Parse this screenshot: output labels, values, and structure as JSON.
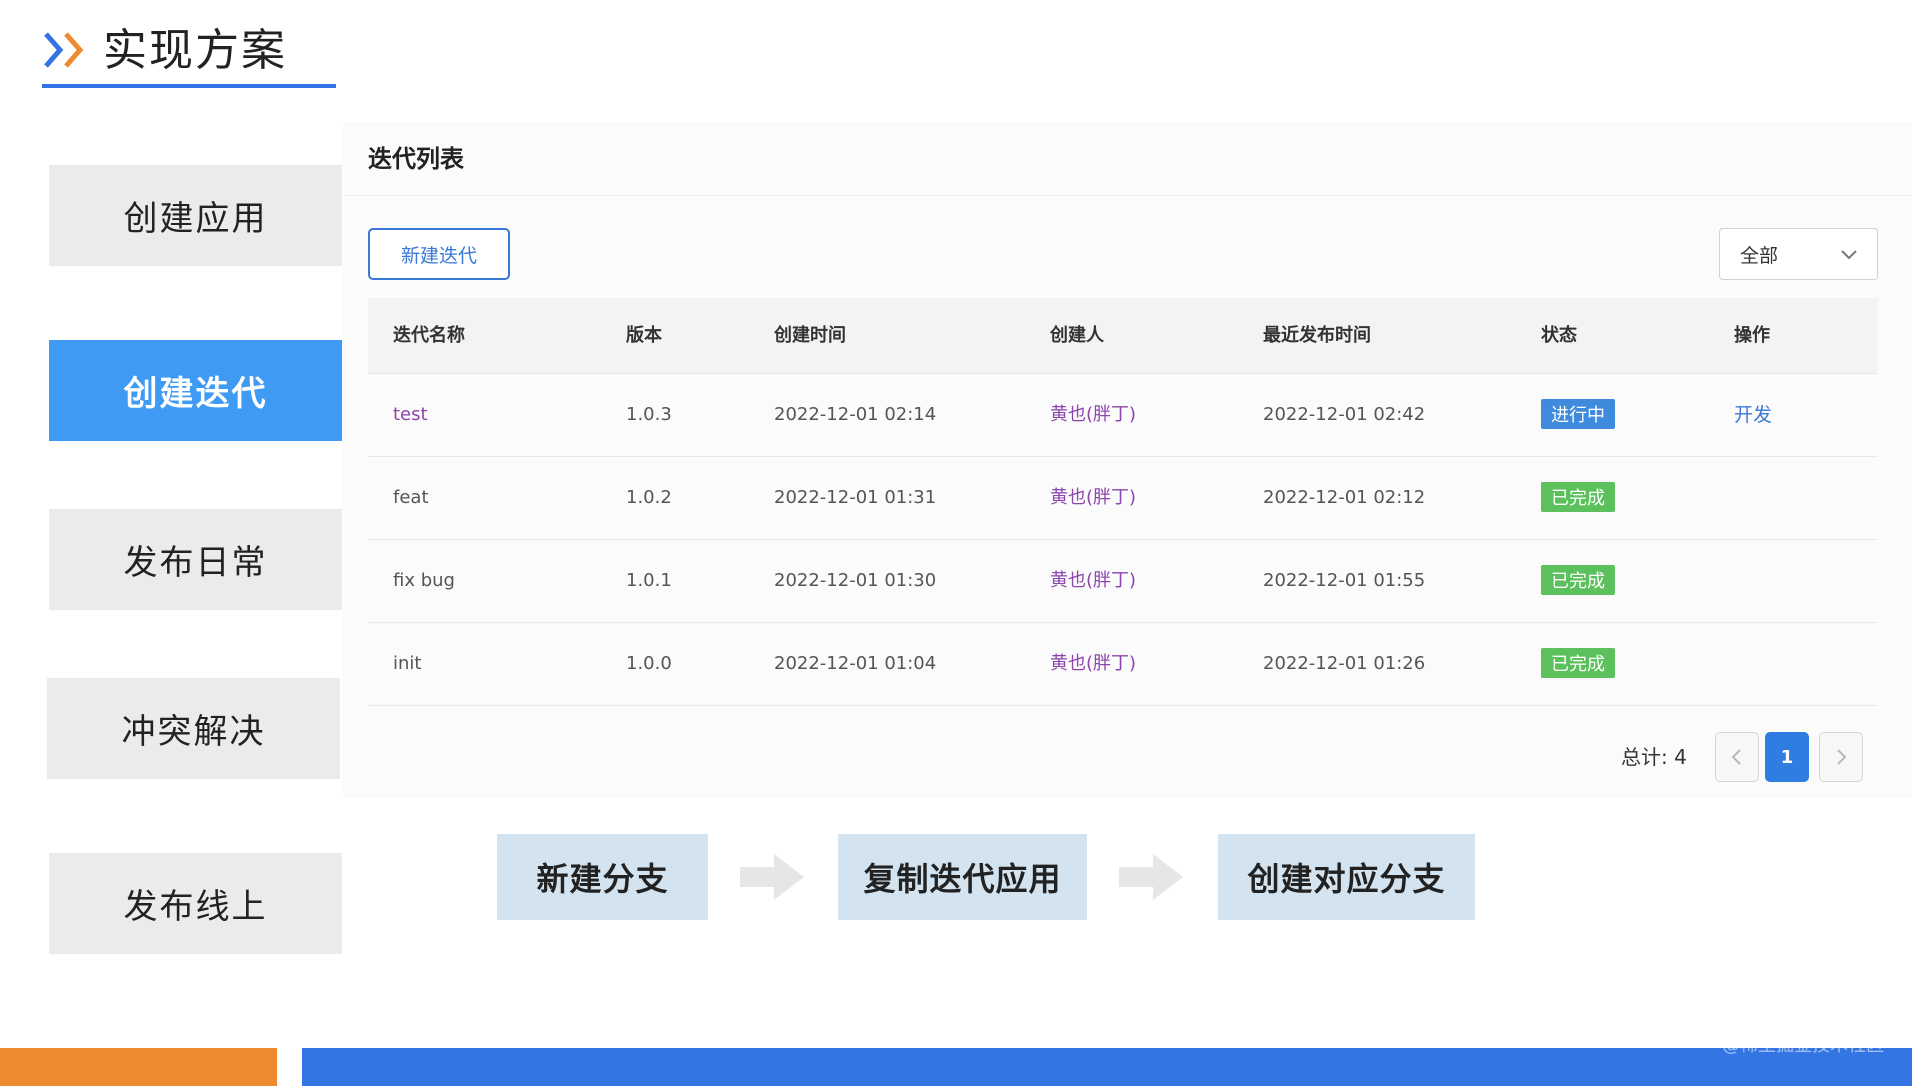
{
  "header": {
    "title": "实现方案"
  },
  "nav": {
    "items": [
      {
        "label": "创建应用",
        "active": false
      },
      {
        "label": "创建迭代",
        "active": true
      },
      {
        "label": "发布日常",
        "active": false
      },
      {
        "label": "冲突解决",
        "active": false
      },
      {
        "label": "发布线上",
        "active": false
      }
    ]
  },
  "panel": {
    "title": "迭代列表",
    "new_button": "新建迭代",
    "filter_value": "全部"
  },
  "table": {
    "columns": [
      "迭代名称",
      "版本",
      "创建时间",
      "创建人",
      "最近发布时间",
      "状态",
      "操作"
    ],
    "rows": [
      {
        "name": "test",
        "version": "1.0.3",
        "created": "2022-12-01 02:14",
        "creator": "黄也(胖丁)",
        "published": "2022-12-01 02:42",
        "status": "进行中",
        "action": "开发"
      },
      {
        "name": "feat",
        "version": "1.0.2",
        "created": "2022-12-01 01:31",
        "creator": "黄也(胖丁)",
        "published": "2022-12-01 02:12",
        "status": "已完成",
        "action": ""
      },
      {
        "name": "fix bug",
        "version": "1.0.1",
        "created": "2022-12-01 01:30",
        "creator": "黄也(胖丁)",
        "published": "2022-12-01 01:55",
        "status": "已完成",
        "action": ""
      },
      {
        "name": "init",
        "version": "1.0.0",
        "created": "2022-12-01 01:04",
        "creator": "黄也(胖丁)",
        "published": "2022-12-01 01:26",
        "status": "已完成",
        "action": ""
      }
    ]
  },
  "pagination": {
    "total_label": "总计: 4",
    "current_page": "1"
  },
  "flow": {
    "steps": [
      "新建分支",
      "复制迭代应用",
      "创建对应分支"
    ]
  },
  "footer": {
    "watermark": "@稀土掘金技术社区"
  },
  "colors": {
    "accent_blue": "#3273e5",
    "active_nav": "#3e9af3",
    "orange": "#ef8a31",
    "status_running": "#3e8bde",
    "status_done": "#5cc15c",
    "link_purple": "#8e44ad"
  }
}
